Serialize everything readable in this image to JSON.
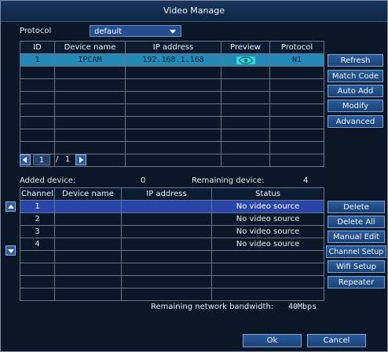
{
  "window": {
    "title": "Video Manage"
  },
  "protocol": {
    "label": "Protocol",
    "value": "default"
  },
  "device_table": {
    "headers": [
      "ID",
      "Device name",
      "IP address",
      "Preview",
      "Protocol"
    ],
    "rows": [
      {
        "id": "1",
        "name": "IPCAM",
        "ip": "192.168.1.168",
        "preview": "eye-icon",
        "protocol": "N1"
      }
    ]
  },
  "side_buttons_top": [
    "Refresh",
    "Match Code",
    "Auto Add",
    "Modify",
    "Advanced"
  ],
  "pagination": {
    "current": "1",
    "separator": "/",
    "total": "1"
  },
  "added": {
    "label": "Added device:",
    "count": "0",
    "remaining_label": "Remaining device:",
    "remaining_count": "4"
  },
  "channel_table": {
    "headers": [
      "Channel",
      "Device name",
      "IP address",
      "Status"
    ],
    "rows": [
      {
        "channel": "1",
        "status": "No video source"
      },
      {
        "channel": "2",
        "status": "No video source"
      },
      {
        "channel": "3",
        "status": "No video source"
      },
      {
        "channel": "4",
        "status": "No video source"
      }
    ]
  },
  "side_buttons_bottom": [
    "Delete",
    "Delete All",
    "Manual Edit",
    "Channel Setup",
    "Wifi Setup",
    "Repeater"
  ],
  "bandwidth": {
    "label": "Remaining network bandwidth:",
    "value": "40Mbps"
  },
  "footer": {
    "ok": "Ok",
    "cancel": "Cancel"
  },
  "colors": {
    "selected_row": "#2489b4",
    "selected_channel_row": "#2a45a8",
    "button": "#1a4276",
    "background": "#0b1627"
  }
}
